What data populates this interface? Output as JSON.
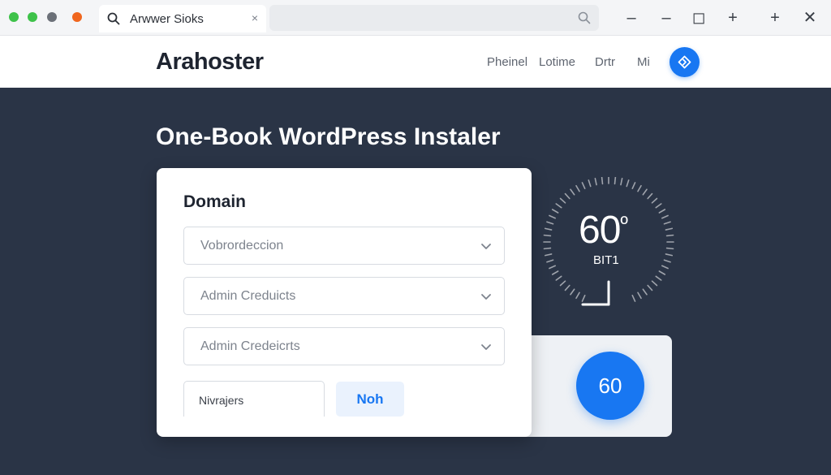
{
  "browser": {
    "tab_title": "Arwwer Sioks",
    "tab_close": "×",
    "window_controls": [
      "– –",
      "–",
      "◻",
      "+",
      "+",
      "✕"
    ]
  },
  "site": {
    "logo": "Arahoster",
    "nav": [
      "Pheinel",
      "Lotime",
      "Drtr",
      "Mi"
    ]
  },
  "main": {
    "title": "One-Book WordPress Instaler",
    "form": {
      "label": "Domain",
      "selects": [
        "Vobrordeccion",
        "Admin Creduicts",
        "Admin Credeicrts"
      ],
      "mini_input": "Nivrajers",
      "button": "Noh"
    },
    "gauge": {
      "value": "60",
      "degree": "º",
      "unit": "BIT1"
    },
    "badge": "60"
  },
  "colors": {
    "accent": "#1877f2",
    "background": "#2a3446",
    "dot_green_1": "#3ec24a",
    "dot_green_2": "#3ec24a",
    "dot_gray": "#6b7078",
    "dot_orange": "#f0661e"
  }
}
